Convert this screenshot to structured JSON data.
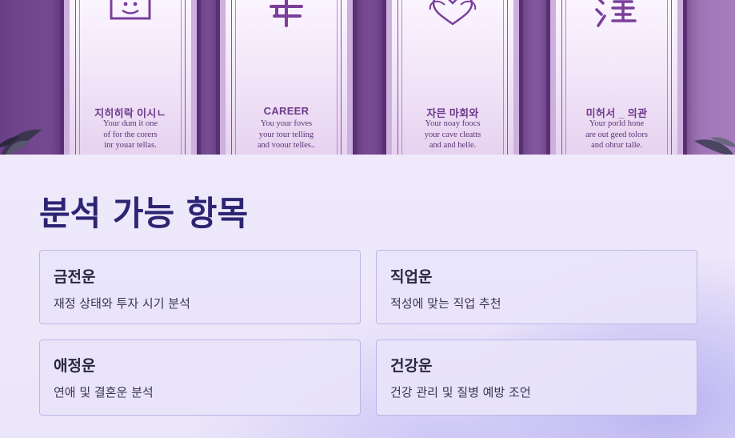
{
  "hero": {
    "panels": [
      {
        "glyph": "face-box-icon",
        "title": "지히히락 이시ㄴ",
        "desc": "Your dum it one\nof for the corers\ninr youar tellas."
      },
      {
        "glyph": "year-char-icon",
        "title": "CAREER",
        "desc": "You your foves\nyour tour telling\nand voour telles.."
      },
      {
        "glyph": "heart-icon",
        "title": "자믄 마회와",
        "desc": "Your noay foocs\nyour cave cleatts\nand and helle."
      },
      {
        "glyph": "health-char-icon",
        "title": "미허서 _ 의관",
        "desc": "Your porld hone\nare out geed tolors\nand ohrur talle."
      }
    ]
  },
  "section": {
    "title": "분석 가능 항목",
    "cards": [
      {
        "title": "금전운",
        "desc": "재정 상태와 투자 시기 분석"
      },
      {
        "title": "직업운",
        "desc": "적성에 맞는 직업 추천"
      },
      {
        "title": "애정운",
        "desc": "연애 및 결혼운 분석"
      },
      {
        "title": "건강운",
        "desc": "건강 관리 및 질병 예방 조언"
      }
    ]
  },
  "colors": {
    "title": "#2c2572",
    "card_bg": "#e8e4fa",
    "card_border": "#bdb6e6",
    "hero_purple": "#7d4f98"
  }
}
